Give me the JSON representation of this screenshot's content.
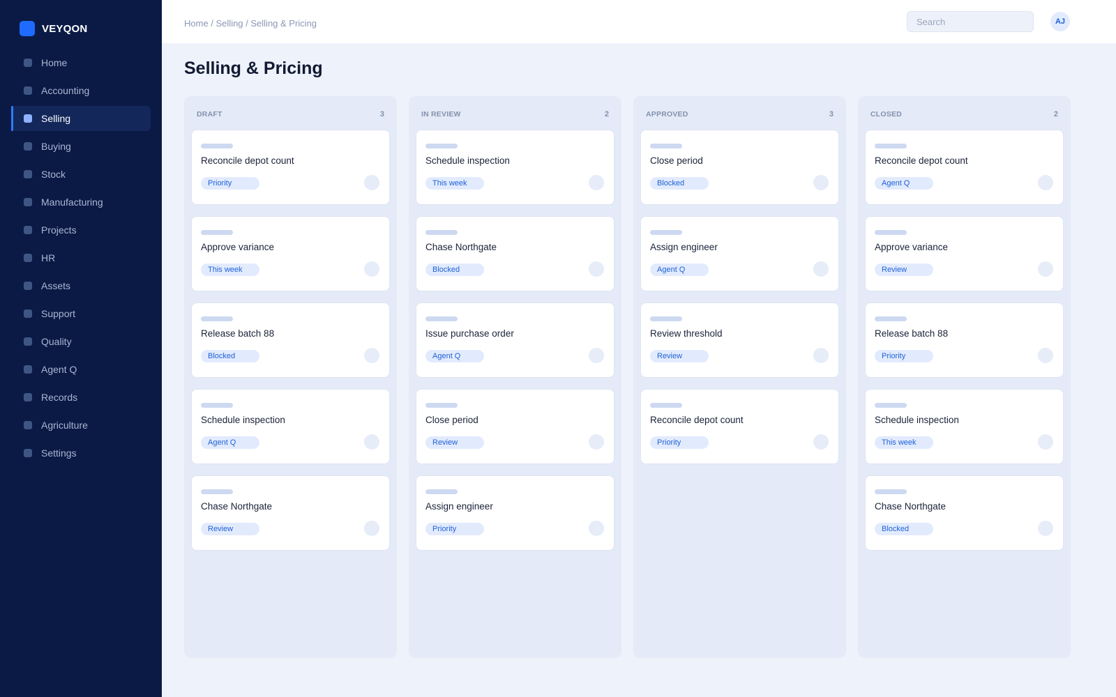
{
  "brand": {
    "name": "VEYQON"
  },
  "sidebar": {
    "items": [
      {
        "label": "Home",
        "active": false
      },
      {
        "label": "Accounting",
        "active": false
      },
      {
        "label": "Selling",
        "active": true
      },
      {
        "label": "Buying",
        "active": false
      },
      {
        "label": "Stock",
        "active": false
      },
      {
        "label": "Manufacturing",
        "active": false
      },
      {
        "label": "Projects",
        "active": false
      },
      {
        "label": "HR",
        "active": false
      },
      {
        "label": "Assets",
        "active": false
      },
      {
        "label": "Support",
        "active": false
      },
      {
        "label": "Quality",
        "active": false
      },
      {
        "label": "Agent Q",
        "active": false
      },
      {
        "label": "Records",
        "active": false
      },
      {
        "label": "Agriculture",
        "active": false
      },
      {
        "label": "Settings",
        "active": false
      }
    ]
  },
  "header": {
    "breadcrumb": "Home / Selling / Selling & Pricing",
    "search_placeholder": "Search",
    "avatar_initials": "AJ"
  },
  "page": {
    "title": "Selling & Pricing"
  },
  "board": {
    "columns": [
      {
        "title": "DRAFT",
        "count": "3",
        "cards": [
          {
            "title": "Reconcile depot count",
            "tag": "Priority"
          },
          {
            "title": "Approve variance",
            "tag": "This week"
          },
          {
            "title": "Release batch 88",
            "tag": "Blocked"
          },
          {
            "title": "Schedule inspection",
            "tag": "Agent Q"
          },
          {
            "title": "Chase Northgate",
            "tag": "Review"
          }
        ]
      },
      {
        "title": "IN REVIEW",
        "count": "2",
        "cards": [
          {
            "title": "Schedule inspection",
            "tag": "This week"
          },
          {
            "title": "Chase Northgate",
            "tag": "Blocked"
          },
          {
            "title": "Issue purchase order",
            "tag": "Agent Q"
          },
          {
            "title": "Close period",
            "tag": "Review"
          },
          {
            "title": "Assign engineer",
            "tag": "Priority"
          }
        ]
      },
      {
        "title": "APPROVED",
        "count": "3",
        "cards": [
          {
            "title": "Close period",
            "tag": "Blocked"
          },
          {
            "title": "Assign engineer",
            "tag": "Agent Q"
          },
          {
            "title": "Review threshold",
            "tag": "Review"
          },
          {
            "title": "Reconcile depot count",
            "tag": "Priority"
          }
        ]
      },
      {
        "title": "CLOSED",
        "count": "2",
        "cards": [
          {
            "title": "Reconcile depot count",
            "tag": "Agent Q"
          },
          {
            "title": "Approve variance",
            "tag": "Review"
          },
          {
            "title": "Release batch 88",
            "tag": "Priority"
          },
          {
            "title": "Schedule inspection",
            "tag": "This week"
          },
          {
            "title": "Chase Northgate",
            "tag": "Blocked"
          }
        ]
      }
    ]
  }
}
